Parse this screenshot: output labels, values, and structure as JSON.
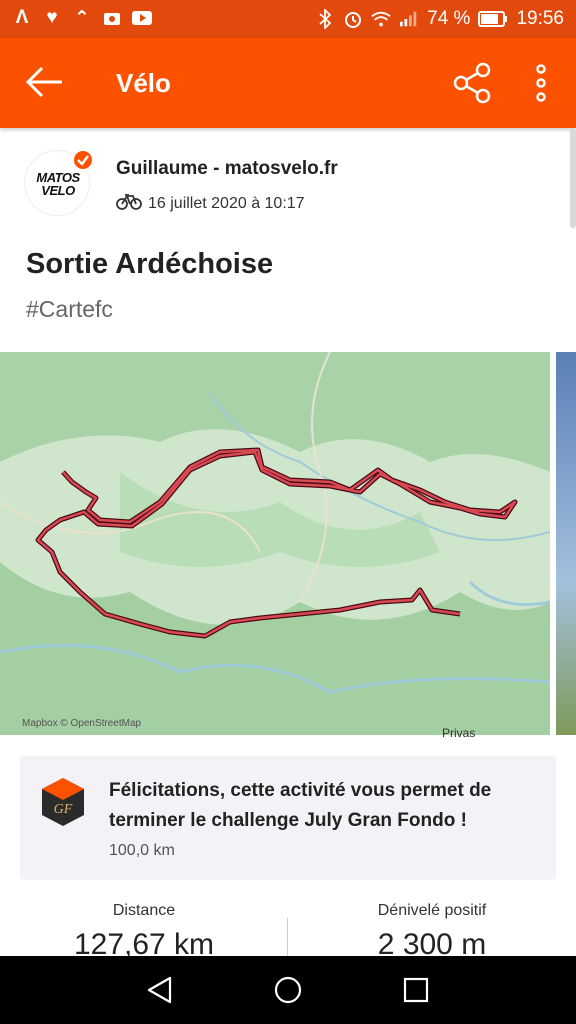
{
  "status_bar": {
    "left_icons": [
      "strava-a-icon",
      "heart-icon",
      "notify-icon",
      "photo-icon",
      "youtube-icon"
    ],
    "right_icons": [
      "bluetooth-icon",
      "alarm-icon",
      "wifi-icon",
      "signal-icon"
    ],
    "battery": "74 %",
    "time": "19:56"
  },
  "app_bar": {
    "title": "Vélo"
  },
  "post": {
    "author": "Guillaume - matosvelo.fr",
    "avatar_logo": "MATOS VELO",
    "date": "16 juillet 2020 à 10:17",
    "title": "Sortie Ardéchoise",
    "hashtag": "#Cartefc"
  },
  "map": {
    "attribution": "Mapbox © OpenStreetMap",
    "label": "Privas"
  },
  "challenge": {
    "text": "Félicitations, cette activité vous permet de terminer le challenge July Gran Fondo !",
    "distance": "100,0 km"
  },
  "stats": [
    {
      "label": "Distance",
      "value": "127,67 km"
    },
    {
      "label": "Dénivelé positif",
      "value": "2 300 m"
    }
  ],
  "colors": {
    "status_bar": "#e2490c",
    "app_bar": "#fc5200",
    "route": "#c0323c",
    "route_dark": "#5a0a1a"
  }
}
